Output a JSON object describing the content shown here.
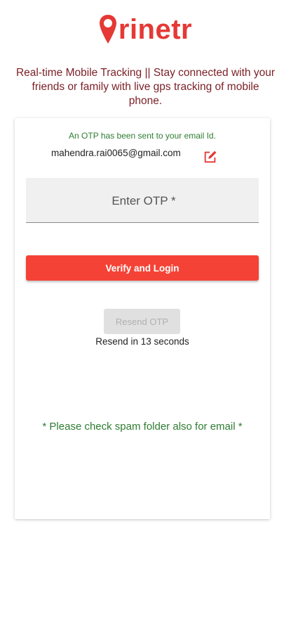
{
  "brand": {
    "name": "rinetr",
    "color": "#e53935",
    "pin_icon": "location-pin-icon"
  },
  "tagline": "Real-time Mobile Tracking || Stay connected with your friends or family with live gps tracking of mobile phone.",
  "otp_card": {
    "sent_message": "An OTP has been sent to your email Id.",
    "email": "mahendra.rai0065@gmail.com",
    "edit_icon": "edit-icon",
    "otp_input": {
      "placeholder": "Enter OTP *",
      "value": ""
    },
    "verify_button_label": "Verify and Login",
    "resend_button_label": "Resend OTP",
    "resend_timer_text": "Resend in 13 seconds",
    "spam_note": "* Please check spam folder also for email *"
  },
  "colors": {
    "primary_red": "#f44336",
    "success_green": "#2e7d32",
    "tagline_maroon": "#7b1f26"
  }
}
